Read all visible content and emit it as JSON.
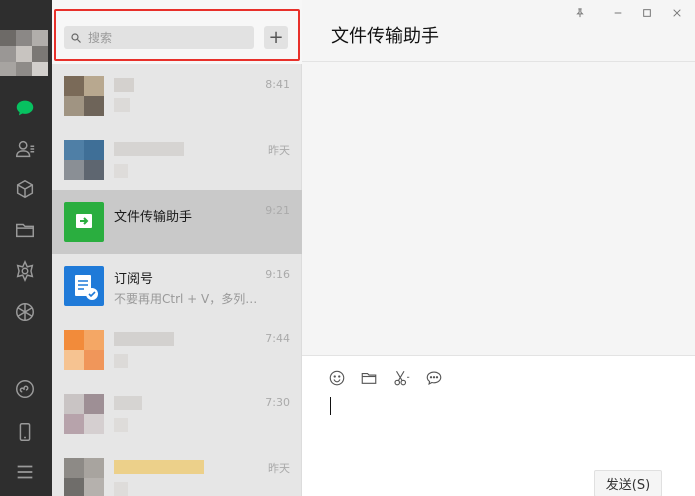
{
  "search": {
    "placeholder": "搜索",
    "add_label": "+"
  },
  "chats": [
    {
      "name": "",
      "preview": "",
      "time": "8:41"
    },
    {
      "name": "",
      "preview": "",
      "time": "昨天"
    },
    {
      "name": "文件传输助手",
      "preview": "",
      "time": "9:21"
    },
    {
      "name": "订阅号",
      "preview": "不要再用Ctrl + V，多列…",
      "time": "9:16"
    },
    {
      "name": "",
      "preview": "",
      "time": "7:44"
    },
    {
      "name": "",
      "preview": "",
      "time": "7:30"
    },
    {
      "name": "",
      "preview": "",
      "time": "昨天"
    }
  ],
  "main": {
    "title": "文件传输助手"
  },
  "composer": {
    "send_label": "发送(S)"
  },
  "colors": {
    "accent_green": "#07c160",
    "highlight_red": "#e8302a",
    "rail_bg": "#2e2e2e",
    "file_helper_green": "#2aae3f",
    "subscription_blue": "#1f7ad8"
  },
  "rail_icons": [
    "chat-icon",
    "contacts-icon",
    "favorites-icon",
    "files-icon",
    "moments-icon",
    "channels-icon",
    "mini-program-icon",
    "phone-icon",
    "menu-icon"
  ],
  "window_controls": [
    "pin-icon",
    "minimize-icon",
    "maximize-icon",
    "close-icon"
  ],
  "composer_tools": [
    "emoji-icon",
    "folder-icon",
    "scissors-icon",
    "chat-history-icon"
  ]
}
